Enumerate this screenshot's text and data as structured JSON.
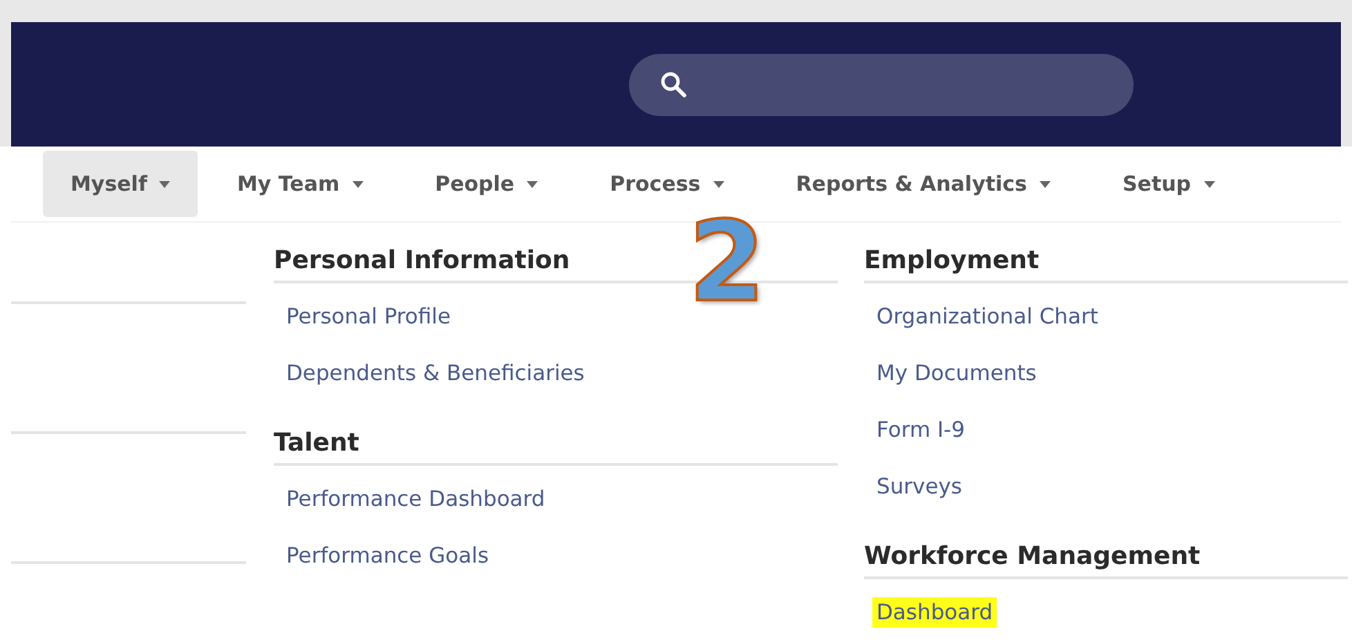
{
  "nav": {
    "items": [
      {
        "label": "Myself",
        "selected": true
      },
      {
        "label": "My Team",
        "selected": false
      },
      {
        "label": "People",
        "selected": false
      },
      {
        "label": "Process",
        "selected": false
      },
      {
        "label": "Reports & Analytics",
        "selected": false
      },
      {
        "label": "Setup",
        "selected": false
      }
    ]
  },
  "menu": {
    "columns": [
      {
        "sections": [
          {
            "heading": "Personal Information",
            "links": [
              {
                "label": "Personal Profile",
                "highlighted": false
              },
              {
                "label": "Dependents & Beneficiaries",
                "highlighted": false
              }
            ]
          },
          {
            "heading": "Talent",
            "links": [
              {
                "label": "Performance Dashboard",
                "highlighted": false
              },
              {
                "label": "Performance Goals",
                "highlighted": false
              }
            ]
          }
        ]
      },
      {
        "sections": [
          {
            "heading": "Employment",
            "links": [
              {
                "label": "Organizational Chart",
                "highlighted": false
              },
              {
                "label": "My Documents",
                "highlighted": false
              },
              {
                "label": "Form I-9",
                "highlighted": false
              },
              {
                "label": "Surveys",
                "highlighted": false
              }
            ]
          },
          {
            "heading": "Workforce Management",
            "links": [
              {
                "label": "Dashboard",
                "highlighted": true
              }
            ]
          }
        ]
      }
    ]
  },
  "annotation": {
    "label": "2"
  }
}
